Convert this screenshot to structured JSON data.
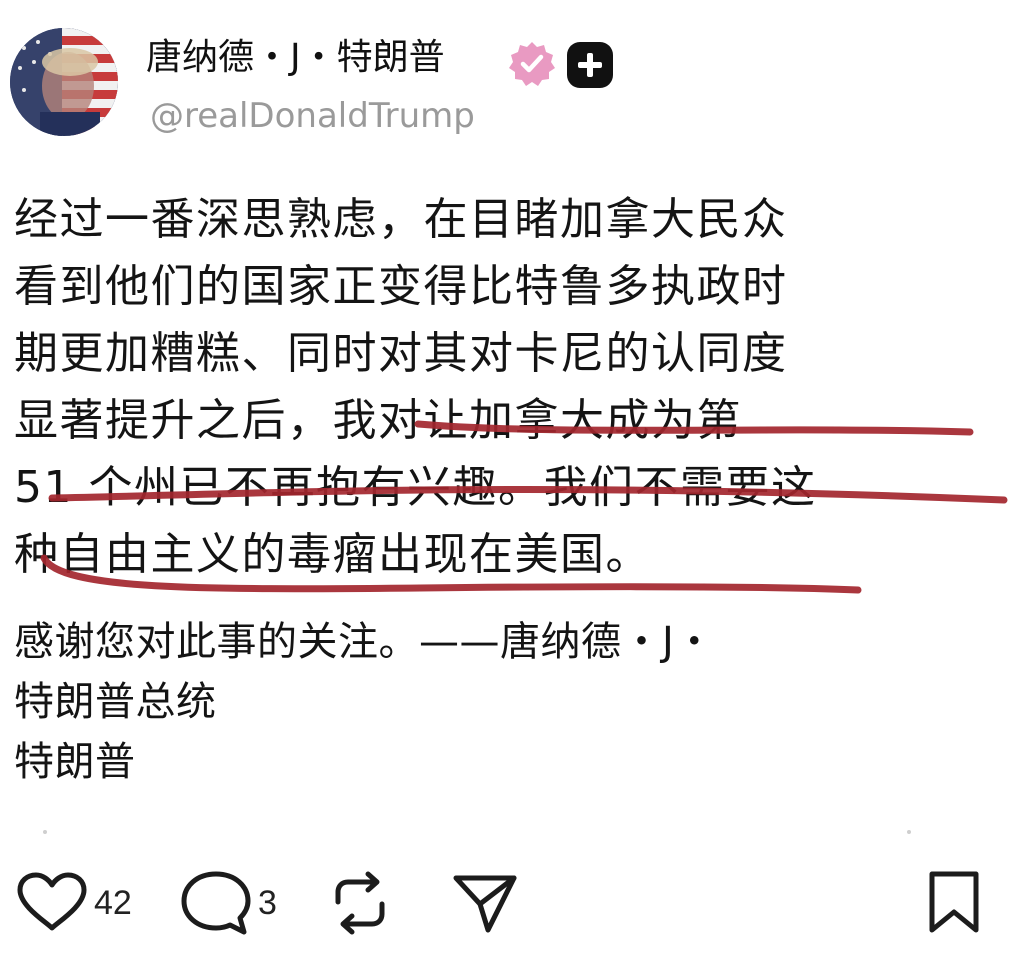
{
  "author": {
    "name": "唐纳德・J・特朗普",
    "handle": "@realDonaldTrump",
    "verified_color": "#e99ac2"
  },
  "post": {
    "lines": [
      "经过一番深思熟虑，在目睹加拿大民众",
      "看到他们的国家正变得比特鲁多执政时",
      "期更加糟糕、同时对其对卡尼的认同度",
      "显著提升之后，我对让加拿大成为第",
      "51 个州已不再抱有兴趣。我们不需要这",
      "种自由主义的毒瘤出现在美国。"
    ],
    "signature_lines": [
      "感谢您对此事的关注。——唐纳德・J・",
      "特朗普总统",
      "特朗普"
    ],
    "underline_color": "#a3262e"
  },
  "actions": {
    "likes": "42",
    "replies": "3"
  }
}
